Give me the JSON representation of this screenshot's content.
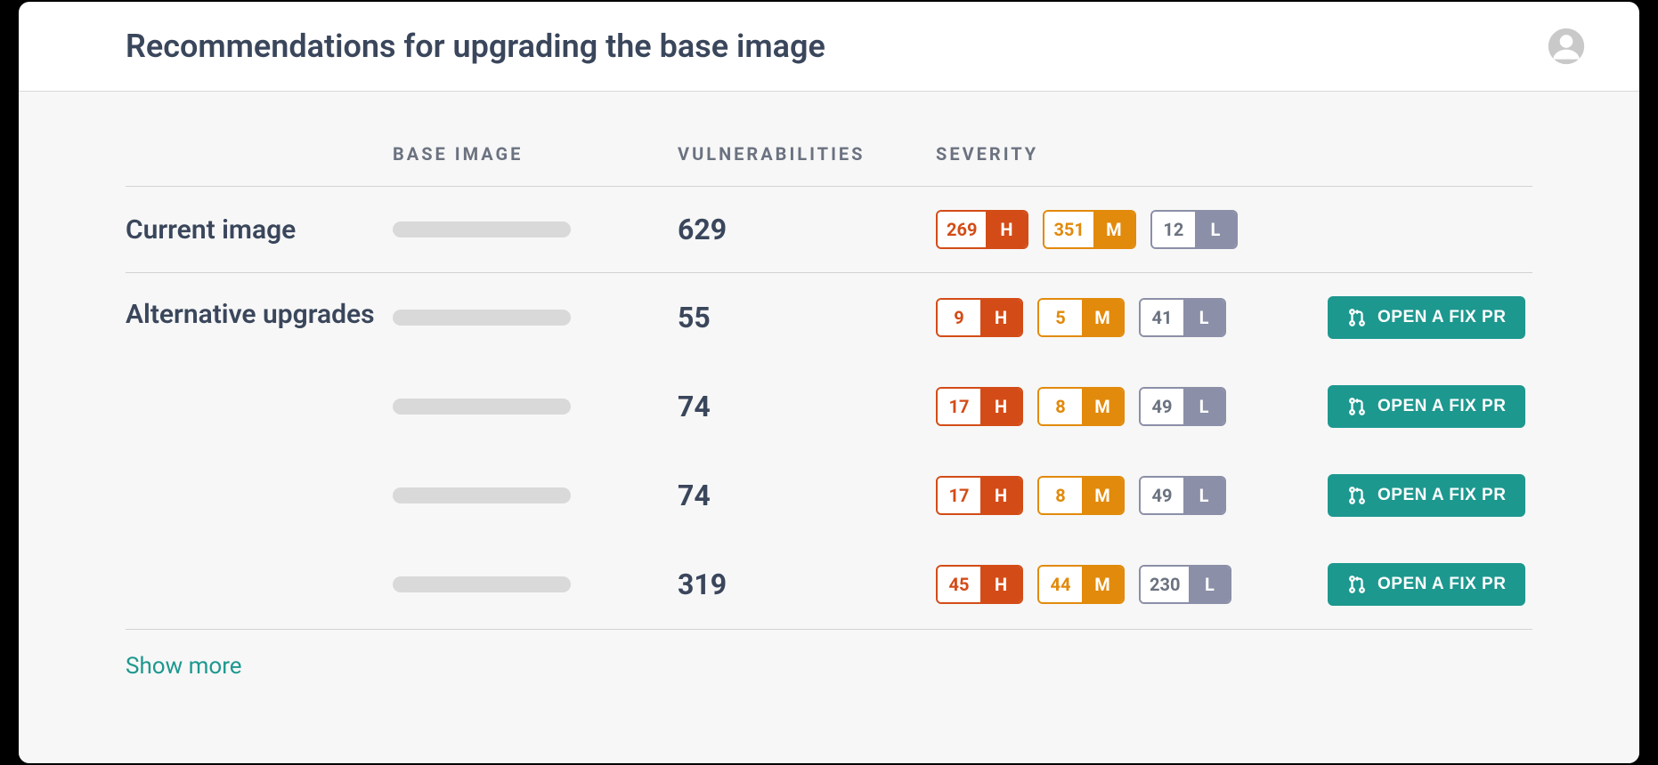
{
  "header": {
    "title": "Recommendations for upgrading the base image"
  },
  "columns": {
    "base_image": "BASE IMAGE",
    "vulnerabilities": "VULNERABILITIES",
    "severity": "SEVERITY"
  },
  "labels": {
    "current": "Current image",
    "alternative": "Alternative upgrades",
    "high": "H",
    "medium": "M",
    "low": "L",
    "fix_button": "OPEN A FIX PR",
    "show_more": "Show more"
  },
  "current": {
    "vulnerabilities": "629",
    "severity": {
      "high": "269",
      "medium": "351",
      "low": "12"
    }
  },
  "alternatives": [
    {
      "vulnerabilities": "55",
      "severity": {
        "high": "9",
        "medium": "5",
        "low": "41"
      }
    },
    {
      "vulnerabilities": "74",
      "severity": {
        "high": "17",
        "medium": "8",
        "low": "49"
      }
    },
    {
      "vulnerabilities": "74",
      "severity": {
        "high": "17",
        "medium": "8",
        "low": "49"
      }
    },
    {
      "vulnerabilities": "319",
      "severity": {
        "high": "45",
        "medium": "44",
        "low": "230"
      }
    }
  ]
}
